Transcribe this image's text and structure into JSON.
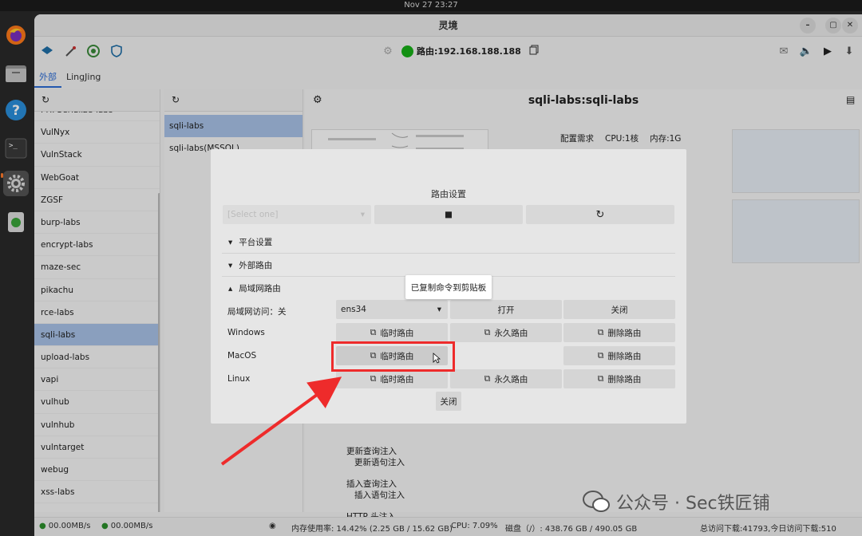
{
  "system": {
    "clock": "Nov 27  23:27"
  },
  "window": {
    "title": "灵境"
  },
  "toolbar": {
    "route_label": "路由:192.168.188.188"
  },
  "tabs": [
    "外部",
    "LingJing"
  ],
  "labs": [
    "PHPSerialize-labs",
    "VulNyx",
    "VulnStack",
    "WebGoat",
    "ZGSF",
    "burp-labs",
    "encrypt-labs",
    "maze-sec",
    "pikachu",
    "rce-labs",
    "sqli-labs",
    "upload-labs",
    "vapi",
    "vulhub",
    "vulnhub",
    "vulntarget",
    "webug",
    "xss-labs"
  ],
  "selected_lab": "sqli-labs",
  "variants": [
    "sqli-labs",
    "sqli-labs(MSSQL)"
  ],
  "main": {
    "title": "sqli-labs:sqli-labs",
    "config_label": "配置需求",
    "cpu": "CPU:1核",
    "memory": "内存:1G",
    "notes": [
      "更新查询注入",
      "更新语句注入",
      "插入查询注入",
      "插入语句注入",
      "HTTP 头注入"
    ]
  },
  "dialog": {
    "title": "路由设置",
    "select_placeholder": "[Select one]",
    "sections": [
      "平台设置",
      "外部路由",
      "局域网路由"
    ],
    "lan_access_label": "局域网访问：关",
    "interface": "ens34",
    "open_label": "打开",
    "close_label": "关闭",
    "rows": [
      {
        "os": "Windows",
        "buttons": [
          "临时路由",
          "永久路由",
          "删除路由"
        ]
      },
      {
        "os": "MacOS",
        "buttons": [
          "临时路由",
          "",
          "删除路由"
        ]
      },
      {
        "os": "Linux",
        "buttons": [
          "临时路由",
          "永久路由",
          "删除路由"
        ]
      }
    ],
    "footer_close": "关闭",
    "tooltip": "已复制命令到剪贴板"
  },
  "statusbar": {
    "upload": "00.00MB/s",
    "download": "00.00MB/s",
    "memory": "内存使用率: 14.42% (2.25 GB / 15.62 GB)",
    "cpu": "CPU: 7.09%",
    "disk": "磁盘（/）: 438.76 GB / 490.05 GB",
    "totals": "总访问下载:41793,今日访问下载:510"
  },
  "watermark": "公众号 · Sec铁匠铺",
  "colors": {
    "accent": "#2b6cd6",
    "selected": "#a9c3e8",
    "annotation": "#ee2b2b",
    "status_ok": "#18b018"
  }
}
